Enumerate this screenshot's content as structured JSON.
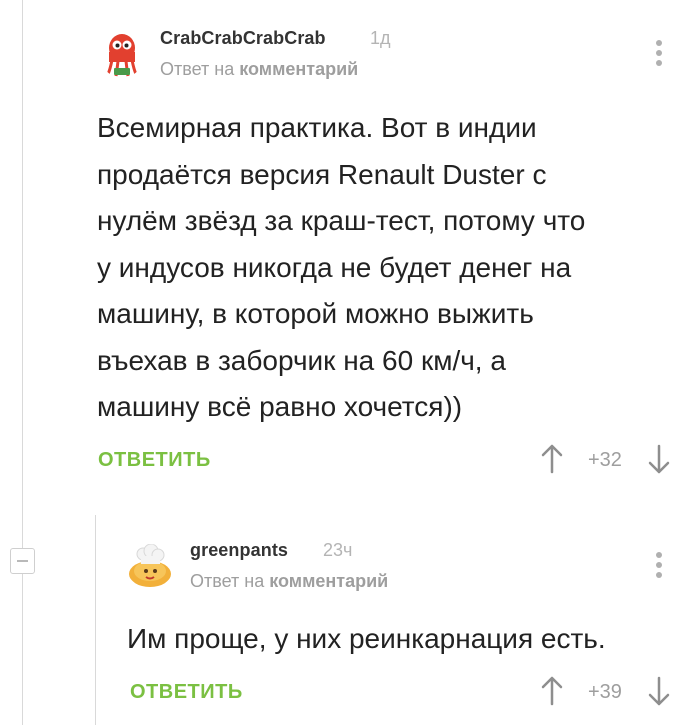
{
  "comments": [
    {
      "username": "CrabCrabCrabCrab",
      "time": "1д",
      "reply_prefix": "Ответ на",
      "reply_target": "комментарий",
      "avatar_icon": "crab-avatar-icon",
      "text_lines": [
        "Всемирная практика. Вот в индии",
        "продаётся версия Renault Duster с",
        "нулём звёзд за краш-тест, потому что",
        "у индусов никогда не будет денег на",
        "машину, в которой можно выжить",
        "въехав в заборчик на 60 км/ч, а",
        "машину всё равно хочется))"
      ],
      "reply_label": "ОТВЕТИТЬ",
      "score": "+32"
    },
    {
      "username": "greenpants",
      "time": "23ч",
      "reply_prefix": "Ответ на",
      "reply_target": "комментарий",
      "avatar_icon": "chef-avatar-icon",
      "text_lines": [
        "Им проще, у них реинкарнация есть."
      ],
      "reply_label": "ОТВЕТИТЬ",
      "score": "+39"
    }
  ],
  "icons": {
    "upvote": "arrow-up-icon",
    "downvote": "arrow-down-icon",
    "menu": "kebab-menu-icon",
    "collapse": "collapse-minus-icon"
  },
  "colors": {
    "accent_green": "#7bc042",
    "muted_gray": "#9e9e9e",
    "thread_line": "#d9d9d9"
  }
}
